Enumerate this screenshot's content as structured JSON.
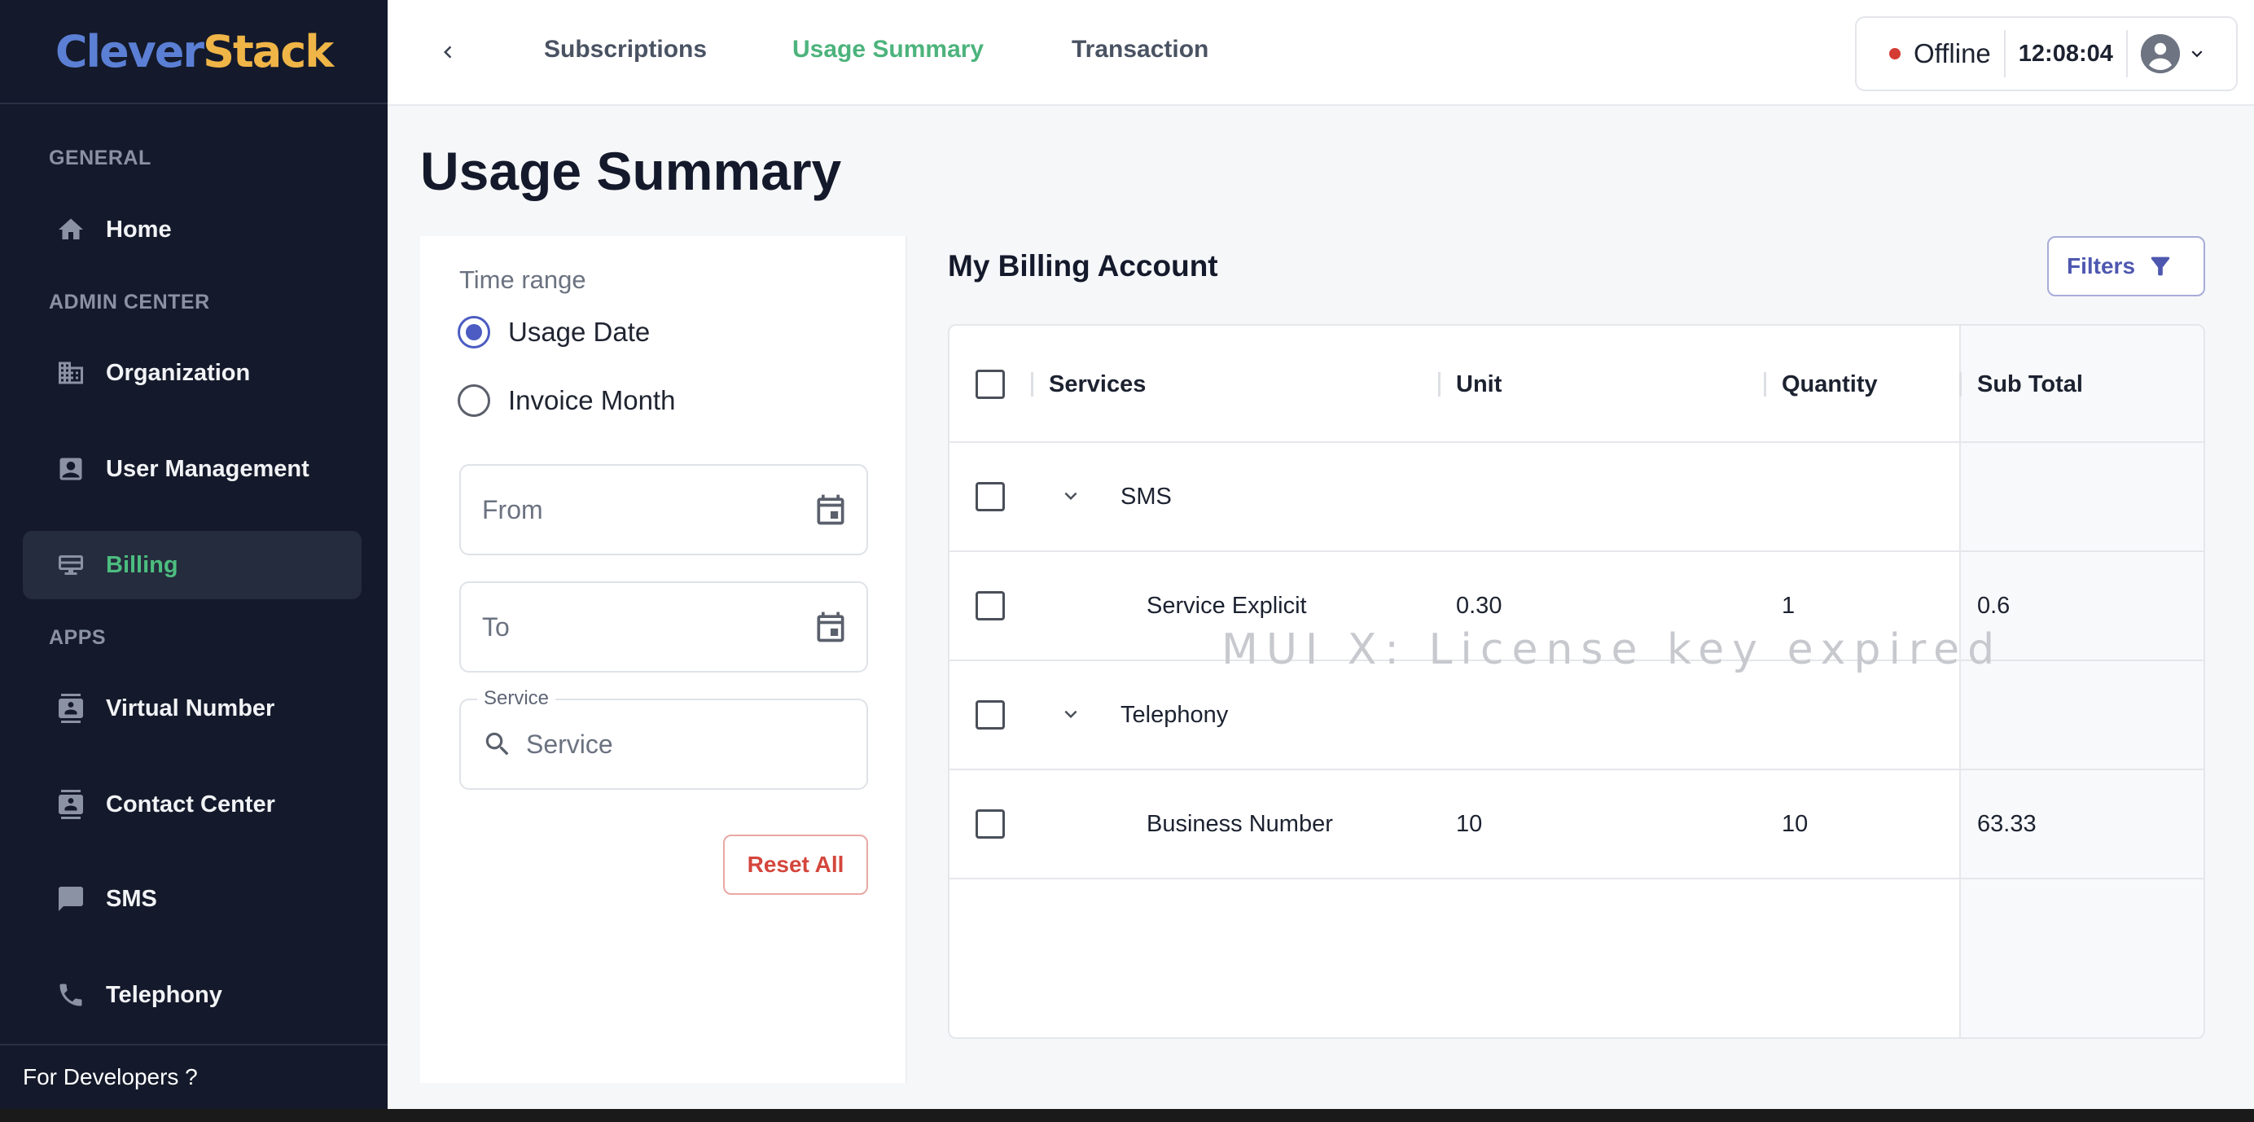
{
  "brand": {
    "part1": "Clever",
    "part2": "Stack"
  },
  "sidebar": {
    "sections": {
      "general": "GENERAL",
      "admin": "ADMIN CENTER",
      "apps": "APPS"
    },
    "items": [
      {
        "label": "Home",
        "icon": "home-icon"
      },
      {
        "label": "Organization",
        "icon": "building-icon"
      },
      {
        "label": "User Management",
        "icon": "user-card-icon"
      },
      {
        "label": "Billing",
        "icon": "billing-icon",
        "active": true
      },
      {
        "label": "Virtual Number",
        "icon": "contact-icon"
      },
      {
        "label": "Contact Center",
        "icon": "contact-icon"
      },
      {
        "label": "SMS",
        "icon": "chat-icon"
      },
      {
        "label": "Telephony",
        "icon": "phone-icon"
      }
    ],
    "footer": "For Developers ?"
  },
  "topbar": {
    "tabs": [
      "Subscriptions",
      "Usage Summary",
      "Transaction"
    ],
    "active_tab": "Usage Summary",
    "status": "Offline",
    "clock": "12:08:04"
  },
  "page": {
    "title": "Usage Summary"
  },
  "filter_panel": {
    "time_range_label": "Time range",
    "options": [
      "Usage Date",
      "Invoice Month"
    ],
    "selected": "Usage Date",
    "from_placeholder": "From",
    "to_placeholder": "To",
    "service_legend": "Service",
    "service_placeholder": "Service",
    "reset_label": "Reset All"
  },
  "billing": {
    "title": "My Billing Account",
    "filters_label": "Filters",
    "columns": [
      "Services",
      "Unit",
      "Quantity",
      "Sub Total"
    ],
    "rows": [
      {
        "type": "group",
        "service": "SMS",
        "unit": "",
        "quantity": "",
        "subtotal": ""
      },
      {
        "type": "item",
        "service": "Service Explicit",
        "unit": "0.30",
        "quantity": "1",
        "subtotal": "0.6"
      },
      {
        "type": "group",
        "service": "Telephony",
        "unit": "",
        "quantity": "",
        "subtotal": ""
      },
      {
        "type": "item",
        "service": "Business Number",
        "unit": "10",
        "quantity": "10",
        "subtotal": "63.33"
      }
    ],
    "watermark": "MUI X: License key expired"
  },
  "colors": {
    "accent_green": "#4cb37c",
    "primary": "#4c5cc2",
    "sidebar_bg": "#141a2b",
    "danger": "#d4463c"
  }
}
